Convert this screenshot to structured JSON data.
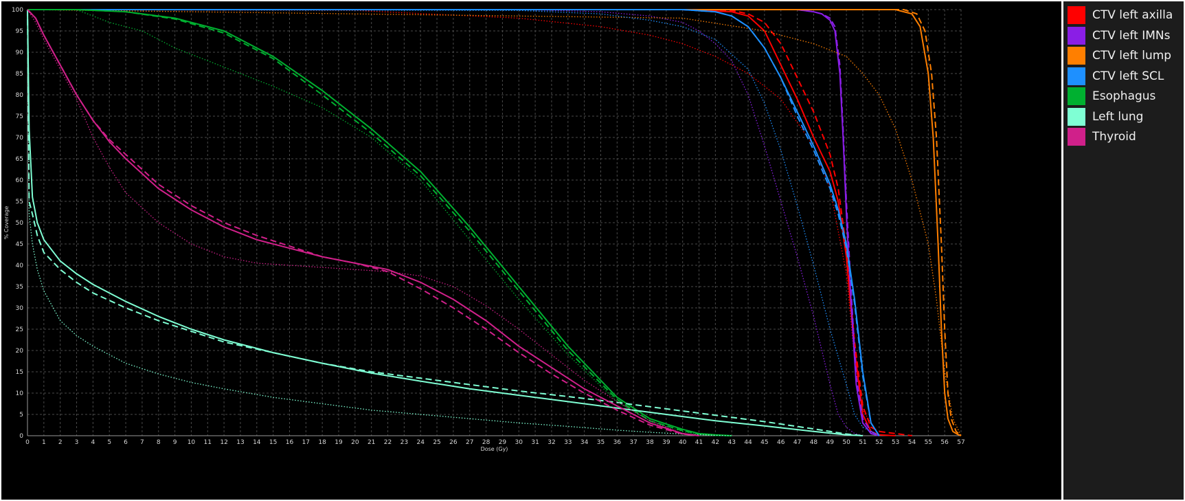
{
  "chart_data": {
    "type": "line",
    "title": "",
    "xlabel": "Dose (Gy)",
    "ylabel": "% Coverage",
    "xlim": [
      0,
      57
    ],
    "ylim": [
      0,
      100
    ],
    "xticks": [
      0,
      1,
      2,
      3,
      4,
      5,
      6,
      7,
      8,
      9,
      10,
      11,
      12,
      13,
      14,
      15,
      16,
      17,
      18,
      19,
      20,
      21,
      22,
      23,
      24,
      25,
      26,
      27,
      28,
      29,
      30,
      31,
      32,
      33,
      34,
      35,
      36,
      37,
      38,
      39,
      40,
      41,
      42,
      43,
      44,
      45,
      46,
      47,
      48,
      49,
      50,
      51,
      52,
      53,
      54,
      55,
      56,
      57
    ],
    "yticks": [
      0,
      5,
      10,
      15,
      20,
      25,
      30,
      35,
      40,
      45,
      50,
      55,
      60,
      65,
      70,
      75,
      80,
      85,
      90,
      95,
      100
    ],
    "grid": true,
    "legend_position": "right",
    "legend": [
      {
        "name": "CTV left axilla",
        "color": "#ff0000"
      },
      {
        "name": "CTV left IMNs",
        "color": "#8a1ee6"
      },
      {
        "name": "CTV left lump",
        "color": "#ff7f00"
      },
      {
        "name": "CTV left SCL",
        "color": "#1e90ff"
      },
      {
        "name": "Esophagus",
        "color": "#00b030"
      },
      {
        "name": "Left lung",
        "color": "#7fffd4"
      },
      {
        "name": "Thyroid",
        "color": "#d0208a"
      }
    ],
    "series": [
      {
        "structure": "CTV left axilla",
        "style": "solid",
        "color": "#ff0000",
        "x": [
          0,
          40,
          43,
          44,
          45,
          46,
          47,
          48,
          49,
          49.5,
          50,
          50.5,
          51,
          51.5,
          52,
          53
        ],
        "y": [
          100,
          100,
          99.5,
          98.5,
          95,
          87,
          79,
          70,
          62,
          55,
          42,
          20,
          5,
          1,
          0.2,
          0
        ]
      },
      {
        "structure": "CTV left axilla",
        "style": "dashed",
        "color": "#ff0000",
        "x": [
          0,
          40,
          43,
          44,
          45,
          46,
          47,
          48,
          49,
          49.5,
          50,
          50.5,
          51,
          51.5,
          52,
          53,
          54
        ],
        "y": [
          100,
          100,
          99.8,
          99,
          97,
          92,
          84,
          76,
          66,
          58,
          44,
          22,
          7,
          2,
          1,
          0.5,
          0
        ]
      },
      {
        "structure": "CTV left axilla",
        "style": "dotted",
        "color": "#ff0000",
        "x": [
          0,
          20,
          30,
          35,
          38,
          40,
          42,
          44,
          46,
          48,
          49,
          50,
          50.5,
          51,
          52
        ],
        "y": [
          100,
          99.8,
          98,
          96,
          94,
          92,
          89,
          85,
          79,
          68,
          58,
          38,
          18,
          6,
          0
        ]
      },
      {
        "structure": "CTV left IMNs",
        "style": "solid",
        "color": "#8a1ee6",
        "x": [
          0,
          47,
          48,
          48.5,
          49,
          49.3,
          49.6,
          49.8,
          50,
          50.3,
          50.6,
          51,
          51.5,
          52
        ],
        "y": [
          100,
          100,
          99.5,
          99,
          97.5,
          95,
          85,
          70,
          52,
          30,
          12,
          3,
          0.5,
          0
        ]
      },
      {
        "structure": "CTV left IMNs",
        "style": "dashed",
        "color": "#8a1ee6",
        "x": [
          0,
          47,
          48,
          48.5,
          49,
          49.3,
          49.6,
          49.8,
          50,
          50.3,
          50.6,
          51,
          51.5,
          52
        ],
        "y": [
          100,
          100,
          99.5,
          99,
          98,
          96,
          87,
          72,
          55,
          33,
          14,
          4,
          1,
          0
        ]
      },
      {
        "structure": "CTV left IMNs",
        "style": "dotted",
        "color": "#8a1ee6",
        "x": [
          0,
          30,
          35,
          38,
          40,
          41,
          42,
          43,
          44,
          45,
          46,
          47,
          48,
          49,
          49.5,
          50,
          50.5,
          51
        ],
        "y": [
          100,
          100,
          99.5,
          98.5,
          97,
          95,
          92,
          88,
          80,
          68,
          55,
          42,
          28,
          12,
          5,
          2,
          0.5,
          0
        ]
      },
      {
        "structure": "CTV left lump",
        "style": "solid",
        "color": "#ff7f00",
        "x": [
          0,
          53,
          54,
          54.5,
          55,
          55.3,
          55.6,
          55.8,
          56,
          56.2,
          56.5,
          56.8,
          57
        ],
        "y": [
          100,
          100,
          99,
          96,
          85,
          70,
          45,
          25,
          10,
          4,
          1,
          0.3,
          0
        ]
      },
      {
        "structure": "CTV left lump",
        "style": "dashed",
        "color": "#ff7f00",
        "x": [
          0,
          53.5,
          54.3,
          54.8,
          55.2,
          55.5,
          55.8,
          56,
          56.2,
          56.4,
          56.7,
          57
        ],
        "y": [
          100,
          100,
          99,
          95,
          85,
          70,
          45,
          25,
          10,
          4,
          1,
          0
        ]
      },
      {
        "structure": "CTV left lump",
        "style": "dotted",
        "color": "#ff7f00",
        "x": [
          0,
          40,
          45,
          48,
          50,
          51,
          52,
          53,
          54,
          55,
          55.5,
          56,
          56.5,
          57
        ],
        "y": [
          100,
          98,
          95,
          92,
          89,
          85,
          80,
          72,
          60,
          45,
          32,
          15,
          4,
          0
        ]
      },
      {
        "structure": "CTV left SCL",
        "style": "solid",
        "color": "#1e90ff",
        "x": [
          0,
          40,
          42,
          43,
          44,
          45,
          46,
          47,
          48,
          49,
          49.5,
          50,
          50.5,
          51,
          51.5,
          52
        ],
        "y": [
          100,
          100,
          99.5,
          98.5,
          96,
          91,
          84,
          76,
          68,
          59,
          53,
          45,
          32,
          15,
          3,
          0
        ]
      },
      {
        "structure": "CTV left SCL",
        "style": "dashed",
        "color": "#1e90ff",
        "x": [
          0,
          40,
          42,
          43,
          44,
          45,
          46,
          47,
          48,
          49,
          49.5,
          50,
          50.5,
          51,
          51.5,
          52
        ],
        "y": [
          100,
          100,
          99.5,
          98.5,
          96,
          91,
          84,
          75,
          67,
          58,
          52,
          44,
          31,
          14,
          3,
          0
        ]
      },
      {
        "structure": "CTV left SCL",
        "style": "dotted",
        "color": "#1e90ff",
        "x": [
          0,
          30,
          35,
          38,
          40,
          42,
          44,
          45,
          46,
          47,
          48,
          49,
          50,
          50.5,
          51,
          52
        ],
        "y": [
          100,
          99.8,
          99,
          97.5,
          96,
          93,
          86,
          78,
          67,
          54,
          40,
          25,
          12,
          5,
          2,
          0
        ]
      },
      {
        "structure": "Esophagus",
        "style": "solid",
        "color": "#00b030",
        "x": [
          0,
          3,
          6,
          9,
          12,
          15,
          18,
          21,
          24,
          27,
          30,
          33,
          36,
          38,
          40,
          41,
          42,
          43
        ],
        "y": [
          100,
          100,
          99.5,
          98,
          95,
          89,
          81,
          72,
          62,
          49,
          35,
          21,
          9,
          4,
          1.5,
          0.5,
          0.2,
          0
        ]
      },
      {
        "structure": "Esophagus",
        "style": "dashed",
        "color": "#00b030",
        "x": [
          0,
          3,
          6,
          9,
          12,
          15,
          18,
          21,
          24,
          27,
          30,
          33,
          36,
          38,
          40,
          41,
          42,
          43
        ],
        "y": [
          100,
          100,
          99.5,
          97.8,
          94.5,
          88.5,
          80,
          71,
          61,
          48,
          34,
          20,
          8.5,
          3.5,
          1.2,
          0.4,
          0.1,
          0
        ]
      },
      {
        "structure": "Esophagus",
        "style": "dotted",
        "color": "#00b030",
        "x": [
          0,
          3,
          5,
          7,
          9,
          11,
          13,
          15,
          18,
          21,
          24,
          27,
          30,
          33,
          36,
          38,
          40,
          41,
          42
        ],
        "y": [
          100,
          100,
          97,
          95,
          91,
          88,
          85,
          82,
          77,
          70,
          60,
          46,
          32,
          19,
          8,
          3.5,
          1,
          0.3,
          0
        ]
      },
      {
        "structure": "Left lung",
        "style": "solid",
        "color": "#7fffd4",
        "x": [
          0,
          0.1,
          0.3,
          0.6,
          1,
          2,
          3,
          4,
          6,
          8,
          10,
          12,
          15,
          18,
          21,
          24,
          27,
          30,
          33,
          36,
          39,
          42,
          45,
          48,
          50,
          51
        ],
        "y": [
          100,
          72,
          56,
          50,
          46,
          41,
          38,
          35.5,
          31.5,
          28,
          25,
          22.5,
          19.5,
          17,
          14.7,
          12.8,
          11,
          9.5,
          8,
          6.5,
          5,
          3.5,
          2.3,
          1,
          0.2,
          0
        ]
      },
      {
        "structure": "Left lung",
        "style": "dashed",
        "color": "#7fffd4",
        "x": [
          0,
          0.1,
          0.3,
          0.6,
          1,
          2,
          3,
          4,
          6,
          8,
          10,
          12,
          15,
          18,
          21,
          24,
          27,
          30,
          33,
          36,
          39,
          42,
          45,
          48,
          50,
          51
        ],
        "y": [
          100,
          55,
          52,
          47,
          43,
          39,
          36,
          33.5,
          30,
          27,
          24.5,
          22,
          19.5,
          17,
          15,
          13.5,
          12,
          10.5,
          9.2,
          7.8,
          6.3,
          4.8,
          3.3,
          1.6,
          0.4,
          0
        ]
      },
      {
        "structure": "Left lung",
        "style": "dotted",
        "color": "#7fffd4",
        "x": [
          0,
          0.1,
          0.3,
          0.6,
          1,
          2,
          3,
          4,
          6,
          8,
          10,
          12,
          15,
          18,
          21,
          24,
          27,
          30,
          33,
          36,
          38,
          40,
          42,
          43
        ],
        "y": [
          100,
          52,
          45,
          39,
          34,
          27,
          23.5,
          21,
          17,
          14.5,
          12.5,
          11,
          9,
          7.5,
          6,
          5,
          4,
          3,
          2.2,
          1.3,
          0.8,
          0.4,
          0.1,
          0
        ]
      },
      {
        "structure": "Thyroid",
        "style": "solid",
        "color": "#d0208a",
        "x": [
          0,
          0.5,
          1,
          2,
          3,
          4,
          5,
          6,
          8,
          10,
          12,
          14,
          16,
          18,
          20,
          22,
          24,
          26,
          28,
          30,
          32,
          34,
          36,
          38,
          40,
          41
        ],
        "y": [
          100,
          98,
          94,
          87,
          80,
          74,
          69,
          65,
          58,
          53,
          49,
          46,
          44,
          42,
          40.5,
          39,
          36,
          32,
          27,
          21,
          16,
          11,
          7,
          3,
          0.5,
          0
        ]
      },
      {
        "structure": "Thyroid",
        "style": "dashed",
        "color": "#d0208a",
        "x": [
          0,
          0.5,
          1,
          2,
          3,
          4,
          5,
          6,
          8,
          10,
          12,
          14,
          16,
          18,
          20,
          22,
          24,
          26,
          28,
          30,
          32,
          34,
          36,
          38,
          40,
          41
        ],
        "y": [
          100,
          98,
          94,
          87,
          80,
          74,
          69.5,
          66,
          59,
          54,
          50,
          47,
          44.5,
          42,
          40.5,
          38.5,
          34.5,
          30,
          25,
          19.5,
          14.5,
          10,
          6,
          2.5,
          0.4,
          0
        ]
      },
      {
        "structure": "Thyroid",
        "style": "dotted",
        "color": "#d0208a",
        "x": [
          0,
          0.5,
          1,
          2,
          3,
          4,
          5,
          6,
          8,
          10,
          12,
          14,
          16,
          18,
          20,
          22,
          24,
          26,
          28,
          30,
          32,
          34,
          36,
          38,
          40,
          41
        ],
        "y": [
          100,
          97,
          93,
          86,
          79,
          70,
          63,
          57,
          50,
          45,
          42,
          40.5,
          40,
          39.5,
          39,
          38.5,
          37.5,
          35,
          30.5,
          25,
          19,
          13,
          8,
          3.5,
          0.5,
          0
        ]
      }
    ]
  }
}
